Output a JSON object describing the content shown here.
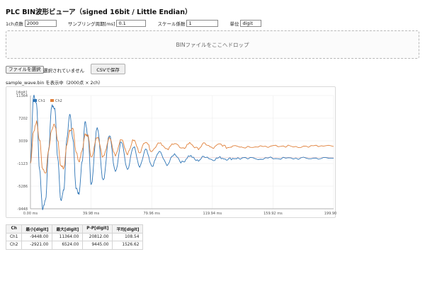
{
  "page": {
    "title": "PLC BIN波形ビューア（signed 16bit / Little Endian）"
  },
  "settings": {
    "points_label": "1ch点数",
    "points_value": "2000",
    "period_label": "サンプリング周期[ms]",
    "period_value": "0.1",
    "scale_label": "スケール係数",
    "scale_value": "1",
    "unit_label": "単位",
    "unit_value": "digit"
  },
  "dropzone": {
    "text": "BINファイルをここへドロップ"
  },
  "file": {
    "choose_label": "ファイルを選択",
    "status": "選択されていません",
    "csv_label": "CSVで保存",
    "showing": "sample_wave.bin を表示中（2000点 × 2ch）"
  },
  "colors": {
    "ch1": "#2e75b6",
    "ch2": "#e0803a",
    "grid": "#ececec",
    "zero": "#e6b8b8"
  },
  "chart_data": {
    "type": "line",
    "title": "",
    "xlabel": "",
    "ylabel": "",
    "yunit": "[digit]",
    "legend": [
      "Ch1",
      "Ch2"
    ],
    "legend_position": "top-left",
    "grid": true,
    "xlim": [
      0,
      199.9
    ],
    "ylim": [
      -9448,
      11364
    ],
    "xticks": [
      "0.00 ms",
      "39.98 ms",
      "79.96 ms",
      "119.94 ms",
      "159.92 ms",
      "199.90 ms"
    ],
    "yticks": [
      "11364",
      "7202",
      "3039",
      "-1123",
      "-5286",
      "-9448"
    ],
    "series": [
      {
        "name": "Ch1",
        "x": [
          0,
          2,
          4,
          6,
          8,
          10,
          12,
          14,
          16,
          18,
          20,
          22,
          24,
          26,
          28,
          30,
          32,
          34,
          36,
          38,
          40,
          44,
          48,
          52,
          56,
          60,
          64,
          68,
          72,
          76,
          80,
          85,
          90,
          95,
          100,
          105,
          110,
          115,
          120,
          125,
          130,
          135,
          140,
          150,
          160,
          170,
          180,
          190,
          199.9
        ],
        "y": [
          -1123,
          11364,
          9800,
          -2200,
          -9448,
          -7800,
          1500,
          9500,
          9000,
          0,
          -8000,
          -6000,
          3500,
          7800,
          3500,
          -5500,
          -6800,
          -1000,
          6500,
          4000,
          -5000,
          5600,
          -4200,
          4200,
          -2700,
          3000,
          -2200,
          2000,
          -1800,
          1400,
          -1600,
          1000,
          -1300,
          600,
          -900,
          300,
          -600,
          200,
          -400,
          -50,
          -300,
          -150,
          -250,
          -200,
          -150,
          -200,
          -180,
          -160,
          -170
        ]
      },
      {
        "name": "Ch2",
        "x": [
          0,
          2,
          4,
          6,
          8,
          10,
          12,
          14,
          16,
          18,
          20,
          22,
          24,
          26,
          28,
          30,
          32,
          34,
          36,
          38,
          40,
          44,
          48,
          52,
          56,
          60,
          64,
          68,
          72,
          76,
          80,
          85,
          90,
          95,
          100,
          105,
          110,
          115,
          120,
          125,
          130,
          135,
          140,
          150,
          160,
          170,
          180,
          190,
          199.9
        ],
        "y": [
          -1123,
          4500,
          6524,
          3200,
          -2000,
          -2921,
          1500,
          5200,
          6000,
          3000,
          -1500,
          -2000,
          2500,
          5000,
          5500,
          1000,
          -800,
          1200,
          4200,
          4000,
          0,
          3800,
          0,
          3500,
          400,
          3400,
          700,
          3200,
          1000,
          3000,
          1200,
          2800,
          1400,
          2700,
          1500,
          2600,
          1600,
          2500,
          1700,
          2400,
          1800,
          2300,
          1900,
          2100,
          2000,
          2050,
          2000,
          2050,
          2000
        ]
      }
    ]
  },
  "stats": {
    "headers": [
      "Ch",
      "最小[digit]",
      "最大[digit]",
      "P-P[digit]",
      "平均[digit]"
    ],
    "rows": [
      [
        "Ch1",
        "-9448.00",
        "11364.00",
        "20812.00",
        "108.54"
      ],
      [
        "Ch2",
        "-2921.00",
        "6524.00",
        "9445.00",
        "1526.62"
      ]
    ]
  }
}
